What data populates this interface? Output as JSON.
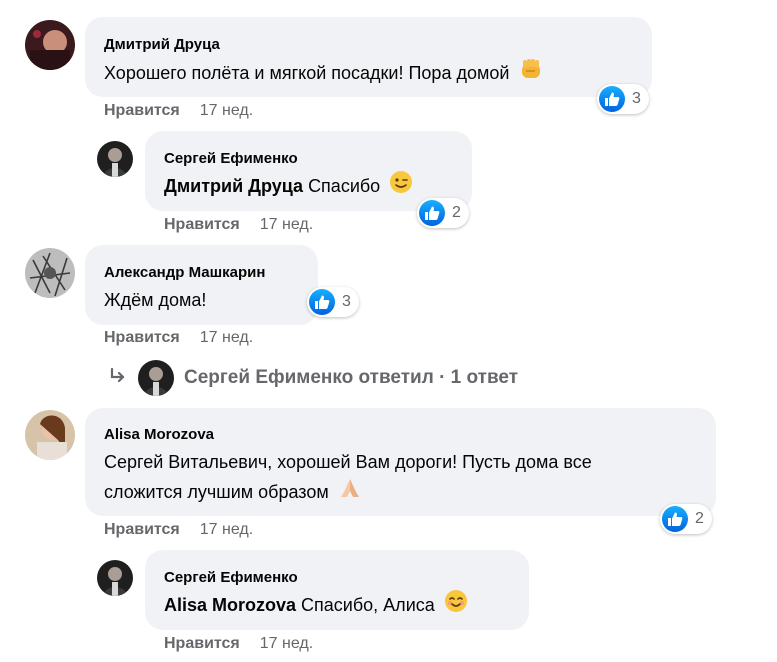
{
  "comments": [
    {
      "author": "Дмитрий Друца",
      "text": "Хорошего полёта и мягкой посадки! Пора домой",
      "emoji": "fist-emoji",
      "like_label": "Нравится",
      "time": "17 нед.",
      "reactions": "3",
      "reply": {
        "author": "Сергей Ефименко",
        "mention": "Дмитрий Друца",
        "text": "Спасибо",
        "emoji": "wink-emoji",
        "like_label": "Нравится",
        "time": "17 нед.",
        "reactions": "2"
      }
    },
    {
      "author": "Александр Машкарин",
      "text": "Ждём дома!",
      "like_label": "Нравится",
      "time": "17 нед.",
      "reactions": "3",
      "replies_summary": "Сергей Ефименко ответил · 1 ответ"
    },
    {
      "author": "Alisa Morozova",
      "text_line1": "Сергей Витальевич, хорошей Вам дороги! Пусть дома все",
      "text_line2": "сложится лучшим образом",
      "emoji": "praying-hands-emoji",
      "like_label": "Нравится",
      "time": "17 нед.",
      "reactions": "2",
      "reply": {
        "author": "Сергей Ефименко",
        "mention": "Alisa Morozova",
        "text": "Спасибо, Алиса",
        "emoji": "smiling-emoji",
        "like_label": "Нравится",
        "time": "17 нед.",
        "reactions": ""
      }
    }
  ],
  "colors": {
    "bubble": "#f0f2f5",
    "meta": "#65676b",
    "like_badge": "#1877f2"
  }
}
